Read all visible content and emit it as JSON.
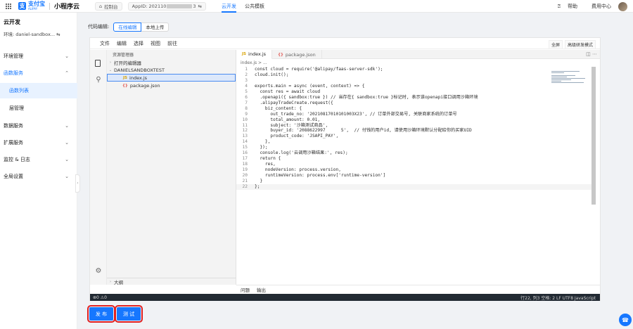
{
  "topbar": {
    "brand_mark": "支",
    "brand_name": "支付宝",
    "brand_sub": "ALIPAY",
    "product": "小程序云",
    "console_label": "控制台",
    "appid_prefix": "AppID: 202110",
    "appid_suffix": "3",
    "tabs": [
      "云开发",
      "公共模板"
    ],
    "help": "帮助",
    "fees": "费用中心"
  },
  "sidebar": {
    "title": "云开发",
    "env": "环境: daniel-sandbox... ⇆",
    "items": [
      {
        "label": "环境管理"
      },
      {
        "label": "函数服务"
      },
      {
        "label": "函数列表"
      },
      {
        "label": "层管理"
      },
      {
        "label": "数据服务"
      },
      {
        "label": "扩展服务"
      },
      {
        "label": "监控 & 日志"
      },
      {
        "label": "全局设置"
      }
    ]
  },
  "editbar": {
    "label": "代码编辑:",
    "online": "在线编辑",
    "upload": "本地上传"
  },
  "ide": {
    "menu": [
      "文件",
      "编辑",
      "选择",
      "视图",
      "前往"
    ],
    "fullscreen": "全屏",
    "advanced": "高级研发模式",
    "explorer_title": "资源管理器",
    "open_editors": "打开的编辑器",
    "project": "DANIELSANDBOXTEST",
    "files": [
      "index.js",
      "package.json"
    ],
    "outline": "大纲",
    "tabs": [
      "index.js",
      "package.json"
    ],
    "breadcrumb": "index.js > ...",
    "panel": [
      "问题",
      "输出"
    ],
    "status_left": "⊗0 ⚠0",
    "status_right": "行22, 列3   空格: 2  LF  UTF8  JavaScript"
  },
  "code": [
    "const cloud = require('@alipay/faas-server-sdk');",
    "cloud.init();",
    "",
    "exports.main = async (event, context) => {",
    "  const res = await cloud",
    "  .openapi({ sandbox:true }) // 当存在{ sandbox:true }标记时, 表示该openapi接口调用沙箱环境",
    "  .alipayTradeCreate.request({",
    "    biz_content: {",
    "      out_trade_no: '20210817010101003X23', // 订单外部交易号, 关联商家系统的订单号",
    "      total_amount: 0.01,",
    "      subject: '沙箱测试商品',",
    "      buyer_id: '2088622997      5',  // 付钱的用户id, 请使用沙箱环境默认分配给你的买家UID",
    "      product_code: 'JSAPI_PAY',",
    "    },",
    "  });",
    "  console.log('云调用沙箱结果:', res);",
    "  return {",
    "    res,",
    "    nodeVersion: process.version,",
    "    runtimeVersion: process.env['runtime-version']",
    "  }",
    "};"
  ],
  "actions": {
    "publish": "发 布",
    "test": "测 试"
  }
}
